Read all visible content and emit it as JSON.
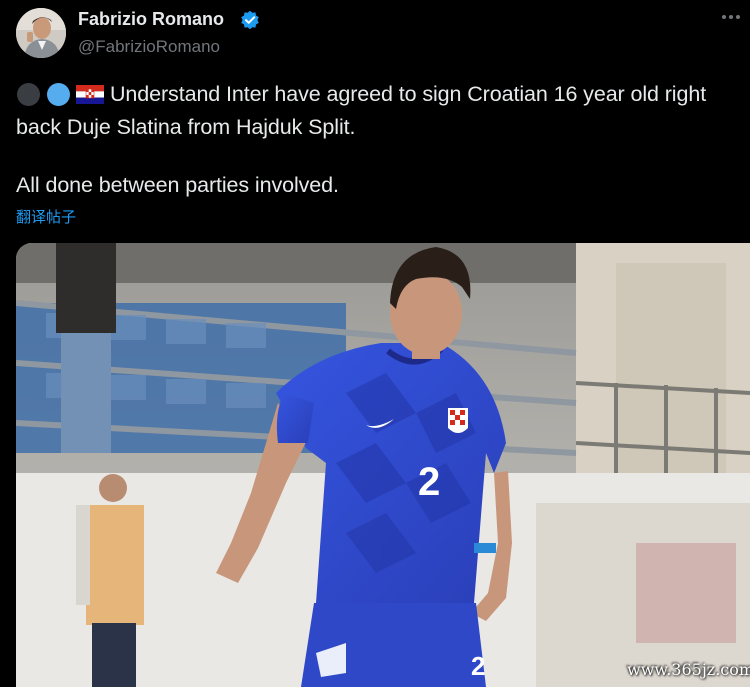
{
  "tweet": {
    "author_name": "Fabrizio Romano",
    "author_handle": "@FabrizioRomano",
    "verified": true,
    "text_line1": "Understand Inter have agreed to sign Croatian 16 year old right",
    "text_line2": "back Duje Slatina from Hajduk Split.",
    "text_line3": "All done between parties involved.",
    "translate_link": "翻译帖子",
    "emojis": [
      "black-circle-icon",
      "blue-circle-icon",
      "croatia-flag-icon"
    ]
  },
  "media": {
    "jersey_number": "2"
  },
  "watermark": "www.365jz.com",
  "colors": {
    "background": "#000000",
    "text": "#e7e9ea",
    "muted": "#71767b",
    "link": "#1d9bf0",
    "verified": "#1d9bf0",
    "kit_blue": "#2f4fd6"
  }
}
